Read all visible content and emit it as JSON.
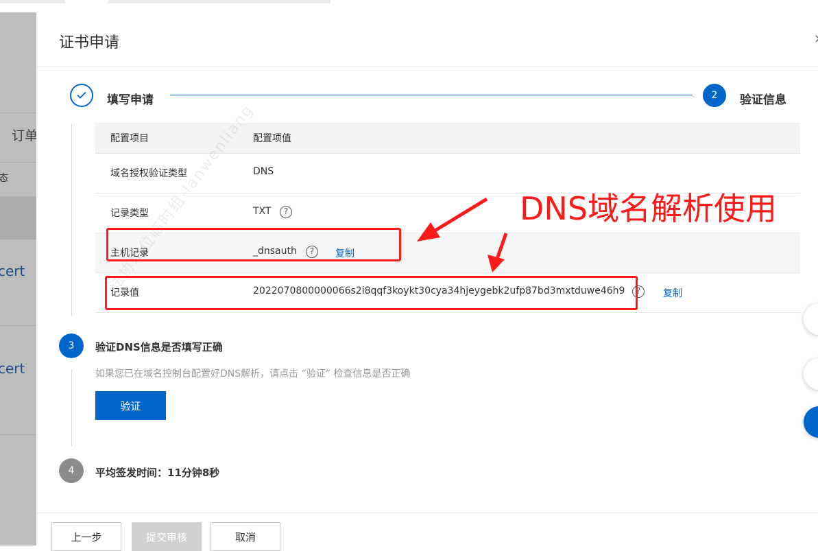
{
  "background": {
    "left_texts": [
      "订单",
      "态",
      "cert",
      "cert"
    ]
  },
  "drawer": {
    "title": "证书申请",
    "close_glyph": "×"
  },
  "steps": {
    "step1_label": "填写申请",
    "step2_number": "2",
    "step2_label": "验证信息"
  },
  "table": {
    "headers": [
      "配置项目",
      "配置项值"
    ],
    "rows": [
      {
        "key": "域名授权验证类型",
        "value": "DNS"
      },
      {
        "key": "记录类型",
        "value": "TXT"
      },
      {
        "key": "主机记录",
        "value": "_dnsauth",
        "copy": "复制"
      },
      {
        "key": "记录值",
        "value": "2022070800000066s2i8qqf3koykt30cya34hjeygebk2ufp87bd3mxtduwe46h9",
        "copy": "复制"
      }
    ]
  },
  "step3": {
    "number": "3",
    "title": "验证DNS信息是否填写正确",
    "hint": "如果您已在域名控制台配置好DNS解析，请点击 “验证” 检查信息是否正确",
    "verify_button": "验证"
  },
  "step4": {
    "number": "4",
    "title": "平均签发时间：11分钟8秒"
  },
  "footer": {
    "prev_button": "上一步",
    "submit_button": "提交审核",
    "cancel_button": "取消"
  },
  "annotation": {
    "text": "DNS域名解析使用",
    "color": "#ff1a1a"
  },
  "watermark": "法协单位临时组-lanwenliang",
  "colors": {
    "primary": "#0066cc",
    "disabled": "#d1d1d1",
    "step_pending": "#8c8c8c"
  }
}
